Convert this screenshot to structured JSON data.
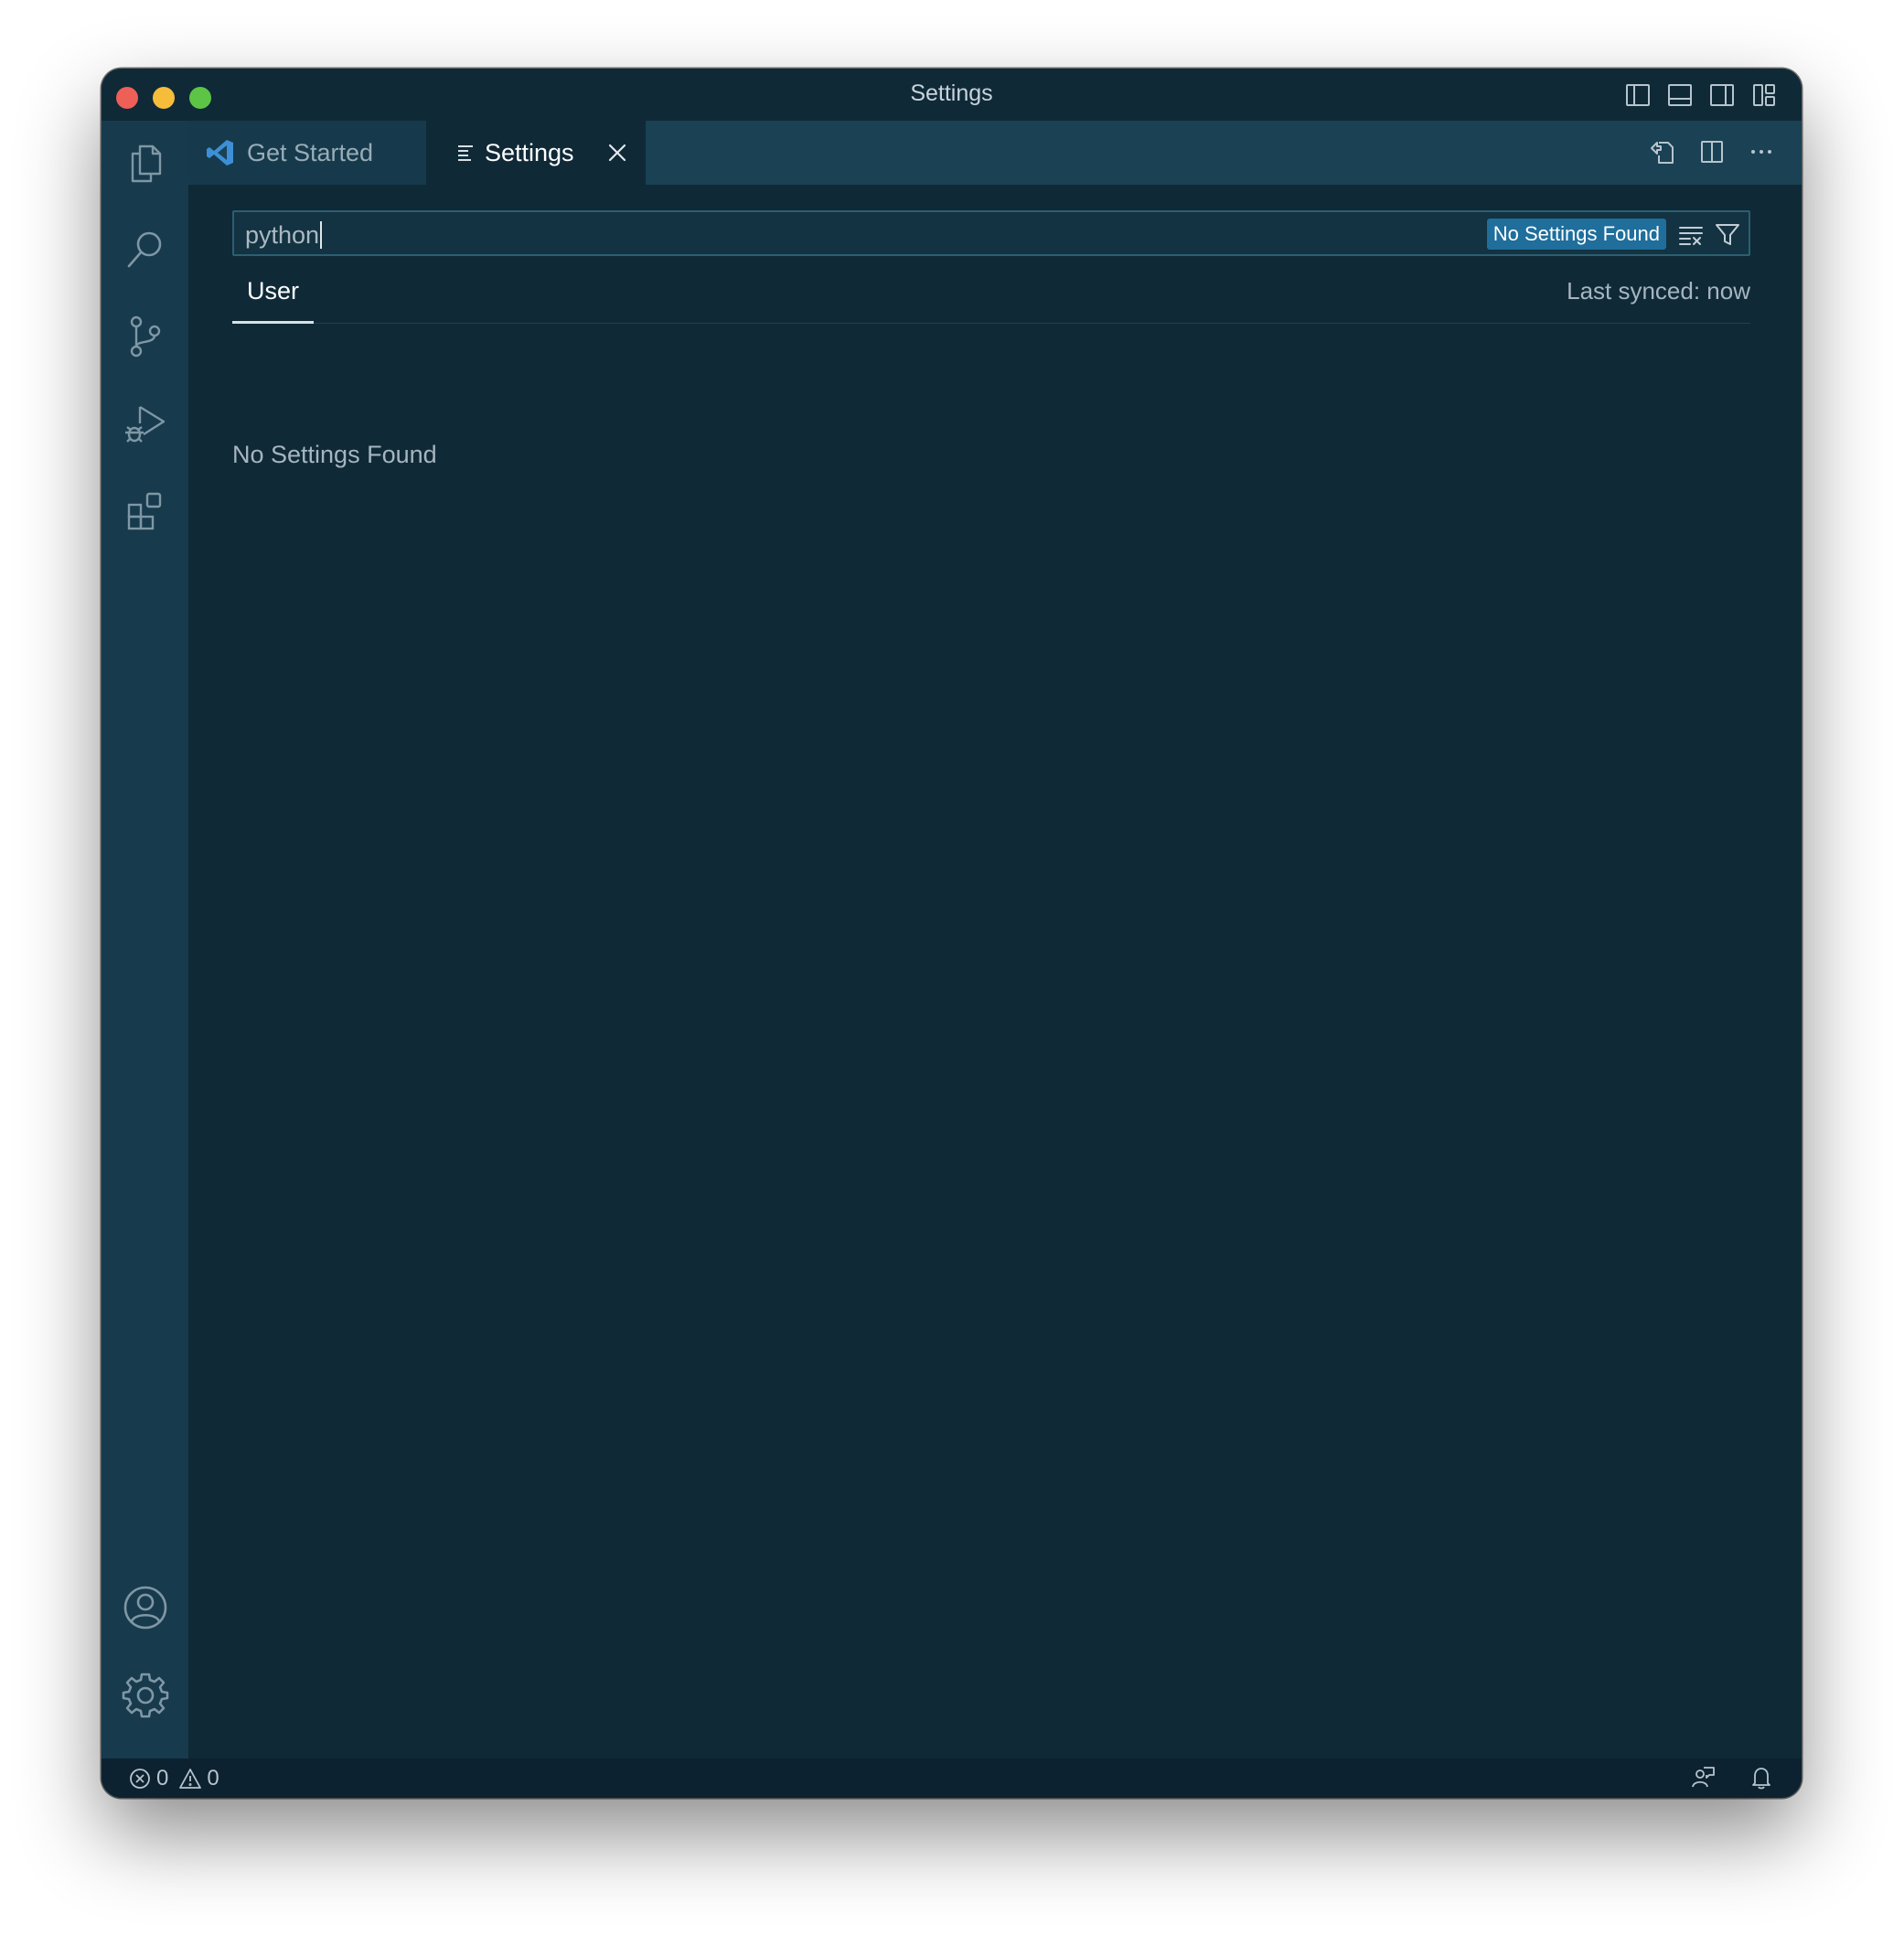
{
  "window": {
    "title": "Settings"
  },
  "tabs": [
    {
      "label": "Get Started",
      "icon": "vscode-logo-icon",
      "active": false
    },
    {
      "label": "Settings",
      "icon": "settings-editor-icon",
      "active": true
    }
  ],
  "search": {
    "value": "python",
    "badge": "No Settings Found"
  },
  "scope": {
    "user_tab": "User",
    "last_synced": "Last synced: now"
  },
  "main": {
    "empty_message": "No Settings Found"
  },
  "statusbar": {
    "errors": "0",
    "warnings": "0"
  },
  "activitybar": {
    "items": [
      "explorer-icon",
      "search-icon",
      "source-control-icon",
      "run-debug-icon",
      "extensions-icon"
    ],
    "bottom": [
      "accounts-icon",
      "manage-gear-icon"
    ]
  },
  "colors": {
    "background": "#0f2937",
    "activitybar": "#173a4c",
    "tabbar": "#1a4154",
    "badge": "#1f6e9c",
    "statusbar": "#0c2230"
  }
}
